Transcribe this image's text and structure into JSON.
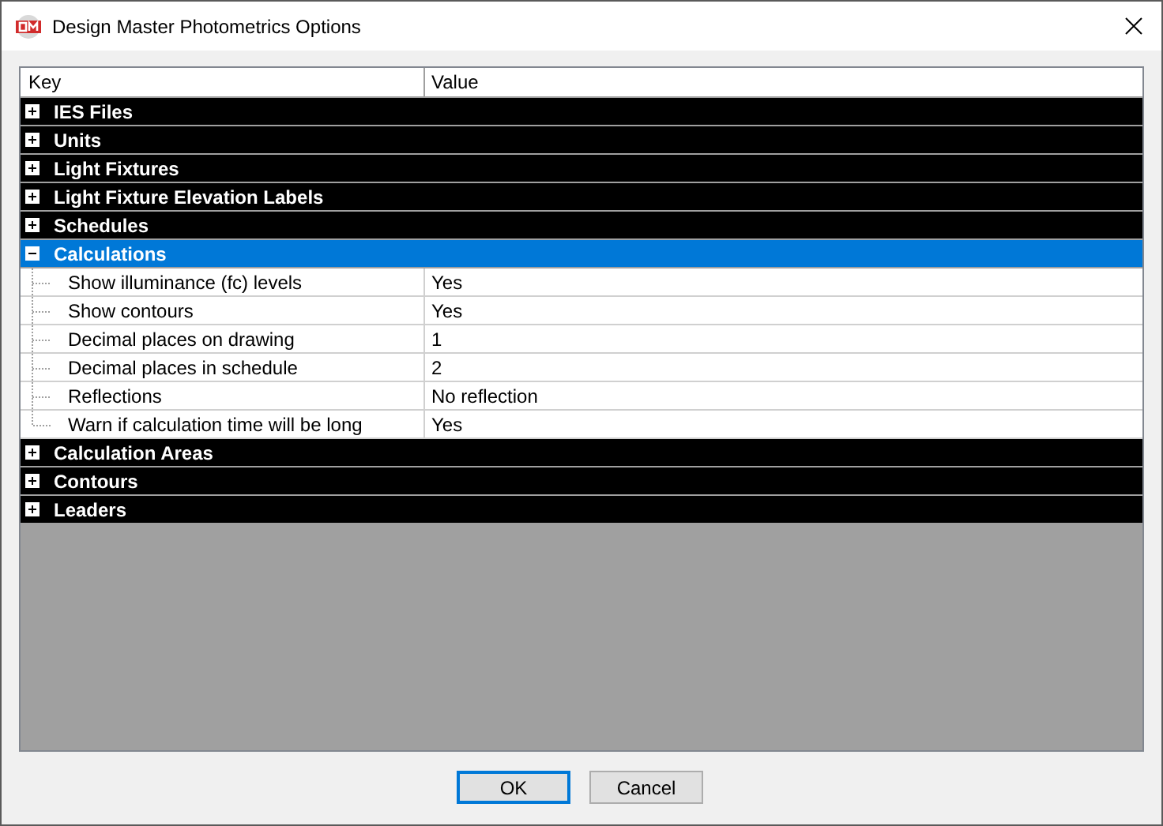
{
  "window": {
    "title": "Design Master Photometrics Options"
  },
  "grid": {
    "columns": [
      "Key",
      "Value"
    ],
    "categories": [
      {
        "name": "IES Files",
        "expanded": false,
        "selected": false
      },
      {
        "name": "Units",
        "expanded": false,
        "selected": false
      },
      {
        "name": "Light Fixtures",
        "expanded": false,
        "selected": false
      },
      {
        "name": "Light Fixture Elevation Labels",
        "expanded": false,
        "selected": false
      },
      {
        "name": "Schedules",
        "expanded": false,
        "selected": false
      },
      {
        "name": "Calculations",
        "expanded": true,
        "selected": true,
        "children": [
          {
            "key": "Show illuminance (fc) levels",
            "value": "Yes"
          },
          {
            "key": "Show contours",
            "value": "Yes"
          },
          {
            "key": "Decimal places on drawing",
            "value": "1"
          },
          {
            "key": "Decimal places in schedule",
            "value": "2"
          },
          {
            "key": "Reflections",
            "value": "No reflection"
          },
          {
            "key": "Warn if calculation time will be long",
            "value": "Yes"
          }
        ]
      },
      {
        "name": "Calculation Areas",
        "expanded": false,
        "selected": false
      },
      {
        "name": "Contours",
        "expanded": false,
        "selected": false
      },
      {
        "name": "Leaders",
        "expanded": false,
        "selected": false
      }
    ]
  },
  "buttons": [
    {
      "label": "OK",
      "default": true
    },
    {
      "label": "Cancel",
      "default": false
    }
  ]
}
